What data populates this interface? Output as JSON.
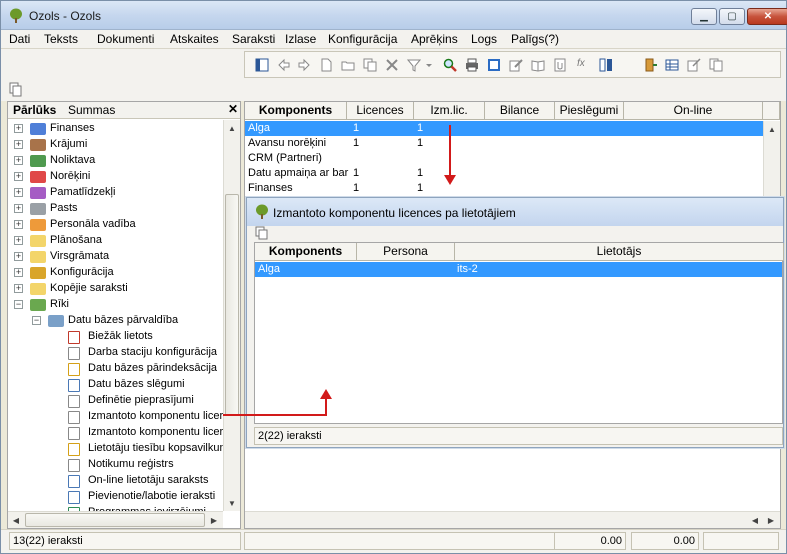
{
  "window": {
    "title": "Ozols - Ozols",
    "controls": {
      "minimize": "▁",
      "maximize": "▢",
      "close": "✕"
    }
  },
  "menu": [
    "Dati",
    "Teksts",
    "Dokumenti",
    "Atskaites",
    "Saraksti",
    "Izlase",
    "Konfigurācija",
    "Aprēķins",
    "Logs",
    "Palīgs(?)"
  ],
  "toolbar_icons": [
    "panel-icon",
    "arrow-left-icon",
    "arrow-right-icon",
    "new-document-icon",
    "open-folder-icon",
    "copy-icon",
    "delete-icon",
    "filter-icon",
    "dropdown-icon",
    "search-icon",
    "print-icon",
    "calculator-icon",
    "edit-icon",
    "book-icon",
    "attach-icon",
    "formula-icon",
    "columns-icon",
    "exit-door-icon",
    "grid-icon",
    "settings-icon",
    "duplicate-icon"
  ],
  "left_pane": {
    "tabs": [
      "Pārlūks",
      "Summas"
    ],
    "close_glyph": "✕",
    "tree": [
      {
        "label": "Finanses",
        "icon": "folder-blue-icon",
        "color": "#4f7fd8",
        "expander": "+",
        "level": 0
      },
      {
        "label": "Krājumi",
        "icon": "folder-brown-icon",
        "color": "#a8734a",
        "expander": "+",
        "level": 0
      },
      {
        "label": "Noliktava",
        "icon": "folder-green-icon",
        "color": "#4f9a4f",
        "expander": "+",
        "level": 0
      },
      {
        "label": "Norēķini",
        "icon": "folder-red-icon",
        "color": "#e04848",
        "expander": "+",
        "level": 0
      },
      {
        "label": "Pamatlīdzekļi",
        "icon": "folder-purple-icon",
        "color": "#a55cc4",
        "expander": "+",
        "level": 0
      },
      {
        "label": "Pasts",
        "icon": "mail-icon",
        "color": "#9aa0a6",
        "expander": "+",
        "level": 0
      },
      {
        "label": "Personāla vadība",
        "icon": "folder-orange-icon",
        "color": "#ee9a3a",
        "expander": "+",
        "level": 0
      },
      {
        "label": "Plānošana",
        "icon": "folder-yellow-icon",
        "color": "#f3d56a",
        "expander": "+",
        "level": 0
      },
      {
        "label": "Virsgrāmata",
        "icon": "folder-yellow-icon",
        "color": "#f3d56a",
        "expander": "+",
        "level": 0
      },
      {
        "label": "Konfigurācija",
        "icon": "gear-icon",
        "color": "#d9a52a",
        "expander": "+",
        "level": 0
      },
      {
        "label": "Kopējie saraksti",
        "icon": "folder-yellow-icon",
        "color": "#f3d56a",
        "expander": "+",
        "level": 0
      },
      {
        "label": "Rīki",
        "icon": "tools-icon",
        "color": "#6aa84f",
        "expander": "−",
        "level": 0
      },
      {
        "label": "Datu bāzes pārvaldība",
        "icon": "database-icon",
        "color": "#7aa0c8",
        "expander": "−",
        "level": 1
      },
      {
        "label": "Biežāk lietots",
        "icon": "clock-icon",
        "color": "#c0392b",
        "expander": "",
        "level": 2
      },
      {
        "label": "Darba staciju konfigurācija",
        "icon": "list-icon",
        "color": "#888888",
        "expander": "",
        "level": 2
      },
      {
        "label": "Datu bāzes pārindeksācija",
        "icon": "reindex-icon",
        "color": "#d4a017",
        "expander": "",
        "level": 2
      },
      {
        "label": "Datu bāzes slēgumi",
        "icon": "lock-search-icon",
        "color": "#4a78b5",
        "expander": "",
        "level": 2
      },
      {
        "label": "Definētie pieprasījumi",
        "icon": "document-icon",
        "color": "#888888",
        "expander": "",
        "level": 2
      },
      {
        "label": "Izmantoto komponentu licer",
        "icon": "document-icon",
        "color": "#888888",
        "expander": "",
        "level": 2
      },
      {
        "label": "Izmantoto komponentu licer",
        "icon": "document-icon",
        "color": "#888888",
        "expander": "",
        "level": 2
      },
      {
        "label": "Lietotāju tiesību kopsavilkun",
        "icon": "key-icon",
        "color": "#d4a017",
        "expander": "",
        "level": 2
      },
      {
        "label": "Notikumu reģistrs",
        "icon": "list-icon",
        "color": "#888888",
        "expander": "",
        "level": 2
      },
      {
        "label": "On-line lietotāju saraksts",
        "icon": "users-search-icon",
        "color": "#4a78b5",
        "expander": "",
        "level": 2
      },
      {
        "label": "Pievienotie/labotie ieraksti",
        "icon": "users-search-icon",
        "color": "#4a78b5",
        "expander": "",
        "level": 2
      },
      {
        "label": "Programmas ievirzējumi",
        "icon": "globe-icon",
        "color": "#2e8b57",
        "expander": "",
        "level": 2
      }
    ]
  },
  "main_grid": {
    "columns": [
      "Komponents",
      "Licences",
      "Izm.lic.",
      "Bilance",
      "Pieslēgumi",
      "On-line"
    ],
    "rows": [
      {
        "komponents": "Alga",
        "licences": "1",
        "izm": "1",
        "selected": true
      },
      {
        "komponents": "Avansu norēķini",
        "licences": "1",
        "izm": "1",
        "selected": false
      },
      {
        "komponents": "CRM (Partneri)",
        "licences": "",
        "izm": "",
        "selected": false
      },
      {
        "komponents": "Datu apmaiņa ar bar",
        "licences": "1",
        "izm": "1",
        "selected": false
      },
      {
        "komponents": "Finanses",
        "licences": "1",
        "izm": "1",
        "selected": false
      }
    ]
  },
  "sub_window": {
    "title": "Izmantoto komponentu licences pa lietotājiem",
    "columns": [
      "Komponents",
      "Persona",
      "Lietotājs"
    ],
    "rows": [
      {
        "komponents": "Alga",
        "persona": "",
        "lietotajs": "its-2",
        "selected": true
      }
    ],
    "status": "2(22) ieraksti"
  },
  "status_bar": {
    "left": "13(22) ieraksti",
    "value1": "0.00",
    "value2": "0.00"
  },
  "colors": {
    "selection": "#3399ff",
    "annotation_arrow": "#d21a1a"
  }
}
